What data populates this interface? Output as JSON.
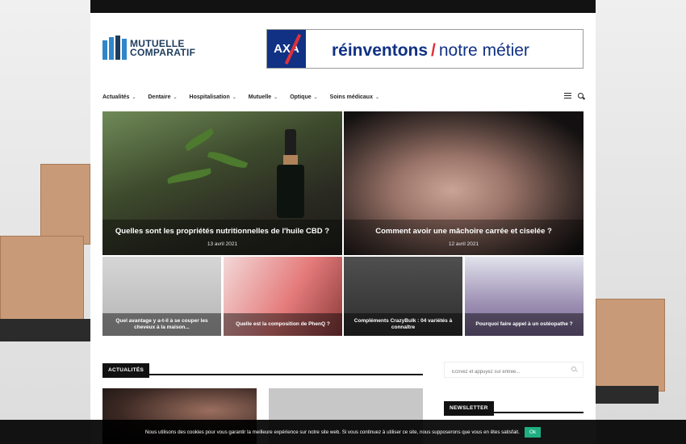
{
  "header": {
    "logo_line1": "MUTUELLE",
    "logo_line2": "COMPARATIF"
  },
  "ad": {
    "brand": "AXA",
    "text_bold": "réinventons",
    "slash": "/",
    "text_rest": "notre métier"
  },
  "nav": {
    "items": [
      {
        "label": "Actualités"
      },
      {
        "label": "Dentaire"
      },
      {
        "label": "Hospitalisation"
      },
      {
        "label": "Mutuelle"
      },
      {
        "label": "Optique"
      },
      {
        "label": "Soins médicaux"
      }
    ]
  },
  "hero": [
    {
      "title": "Quelles sont les propriétés nutritionnelles de l'huile CBD ?",
      "date": "13 avril 2021"
    },
    {
      "title": "Comment avoir une mâchoire carrée et ciselée ?",
      "date": "12 avril 2021"
    }
  ],
  "grid": [
    {
      "title": "Quel avantage y a-t-il à se couper les cheveux à la maison..."
    },
    {
      "title": "Quelle est la composition de PhenQ ?"
    },
    {
      "title": "Compléments CrazyBulk : 04 variétés à connaître"
    },
    {
      "title": "Pourquoi faire appel à un ostéopathe ?"
    }
  ],
  "section": {
    "label": "ACTUALITÉS"
  },
  "sidebar": {
    "search_placeholder": "Écrivez et appuyez sur entrée...",
    "newsletter_label": "NEWSLETTER"
  },
  "cookie": {
    "text": "Nous utilisons des cookies pour vous garantir la meilleure expérience sur notre site web. Si vous continuez à utiliser ce site, nous supposerons que vous en êtes satisfait.",
    "button": "Ok"
  },
  "colors": {
    "brand": "#2f86c9",
    "accent": "#1fae82",
    "dark": "#111111"
  }
}
